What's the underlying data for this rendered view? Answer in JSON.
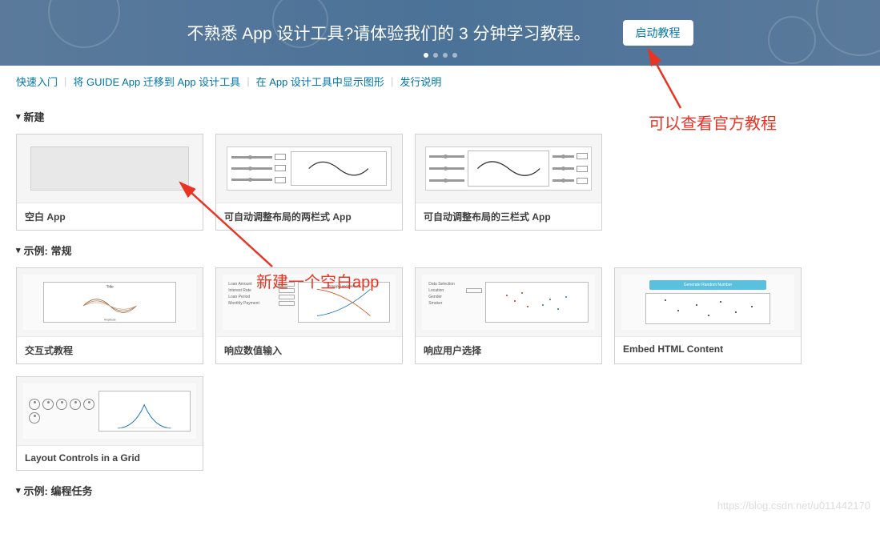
{
  "banner": {
    "text": "不熟悉 App 设计工具?请体验我们的 3 分钟学习教程。",
    "button": "启动教程"
  },
  "nav": {
    "links": [
      "快速入门",
      "将 GUIDE App 迁移到 App 设计工具",
      "在 App 设计工具中显示图形",
      "发行说明"
    ]
  },
  "sections": {
    "new": {
      "title": "新建",
      "cards": [
        {
          "label": "空白 App"
        },
        {
          "label": "可自动调整布局的两栏式 App"
        },
        {
          "label": "可自动调整布局的三栏式 App"
        }
      ]
    },
    "examples_general": {
      "title": "示例: 常规",
      "cards": [
        {
          "label": "交互式教程"
        },
        {
          "label": "响应数值输入"
        },
        {
          "label": "响应用户选择"
        },
        {
          "label": "Embed HTML Content"
        },
        {
          "label": "Layout Controls in a Grid"
        }
      ]
    },
    "examples_programming": {
      "title": "示例: 编程任务"
    }
  },
  "annotations": {
    "top": "可以查看官方教程",
    "mid": "新建一个空白app"
  },
  "watermark": "https://blog.csdn.net/u011442170"
}
